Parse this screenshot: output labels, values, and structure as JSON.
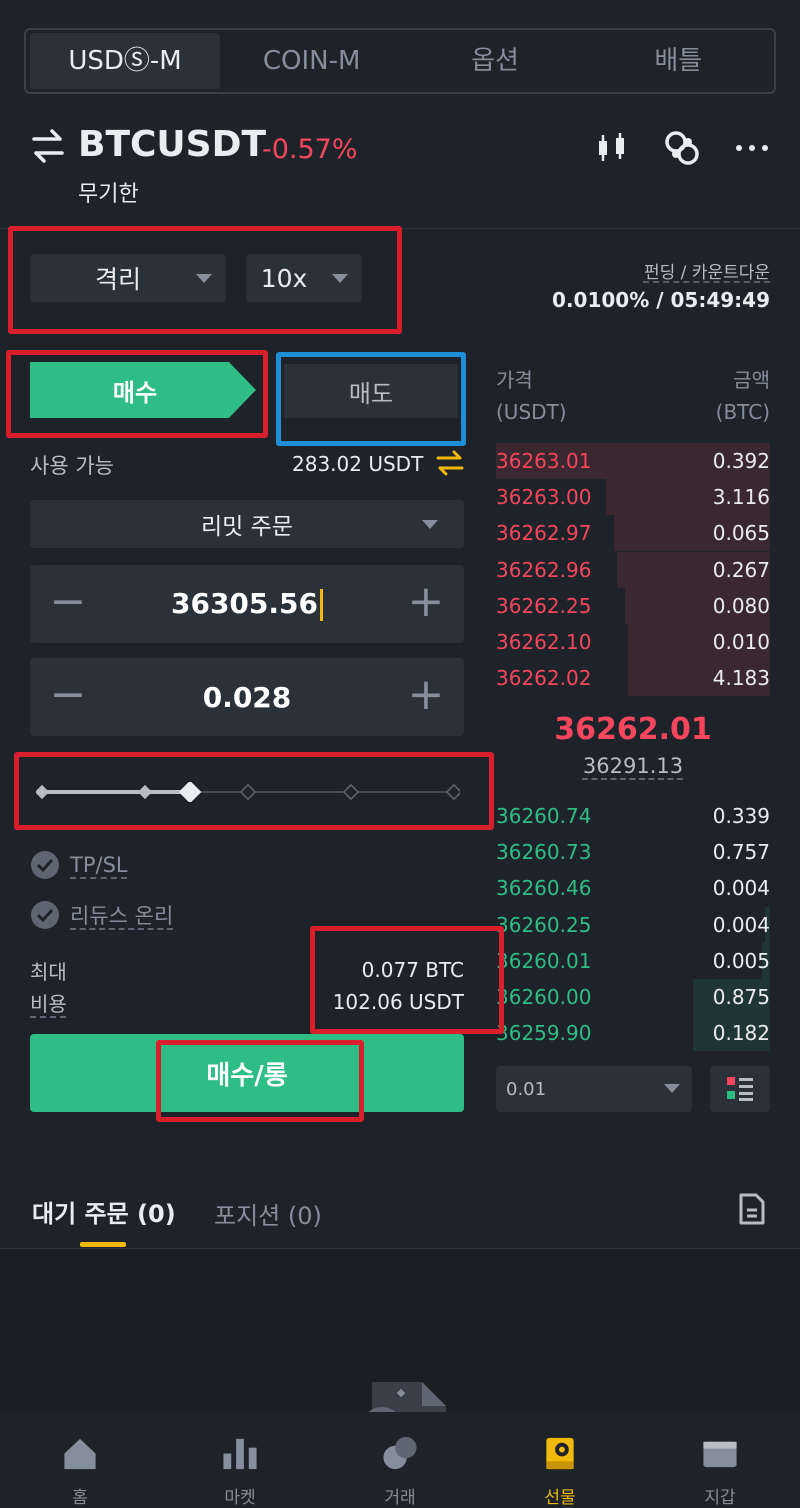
{
  "top_tabs": [
    "USDⓈ-M",
    "COIN-M",
    "옵션",
    "배틀"
  ],
  "header": {
    "symbol": "BTCUSDT",
    "change": "-0.57%",
    "contract_type": "무기한"
  },
  "margin": {
    "mode": "격리",
    "leverage": "10x"
  },
  "funding": {
    "label": "펀딩 / 카운트다운",
    "value": "0.0100% / 05:49:49"
  },
  "side_tabs": {
    "buy": "매수",
    "sell": "매도"
  },
  "available": {
    "label": "사용 가능",
    "value": "283.02 USDT"
  },
  "order_type": "리밋 주문",
  "price_input": {
    "value": "36305.56"
  },
  "amount_input": {
    "value": "0.028"
  },
  "leverage_slider": {
    "percent": 25
  },
  "options": {
    "tpsl": "TP/SL",
    "reduce_only": "리듀스 온리"
  },
  "summary": {
    "max_label": "최대",
    "cost_label": "비용",
    "max_value": "0.077 BTC",
    "cost_value": "102.06 USDT"
  },
  "submit_label": "매수/롱",
  "orderbook": {
    "price_header": "가격",
    "price_unit": "(USDT)",
    "amount_header": "금액",
    "amount_unit": "(BTC)",
    "asks": [
      {
        "price": "36263.01",
        "qty": "0.392",
        "depth": 1.0
      },
      {
        "price": "36263.00",
        "qty": "3.116",
        "depth": 0.6
      },
      {
        "price": "36262.97",
        "qty": "0.065",
        "depth": 0.57
      },
      {
        "price": "36262.96",
        "qty": "0.267",
        "depth": 0.56
      },
      {
        "price": "36262.25",
        "qty": "0.080",
        "depth": 0.53
      },
      {
        "price": "36262.10",
        "qty": "0.010",
        "depth": 0.52
      },
      {
        "price": "36262.02",
        "qty": "4.183",
        "depth": 0.52
      }
    ],
    "last_price": "36262.01",
    "mark_price": "36291.13",
    "bids": [
      {
        "price": "36260.74",
        "qty": "0.339",
        "depth": 0.0
      },
      {
        "price": "36260.73",
        "qty": "0.757",
        "depth": 0.0
      },
      {
        "price": "36260.46",
        "qty": "0.004",
        "depth": 0.0
      },
      {
        "price": "36260.25",
        "qty": "0.004",
        "depth": 0.02
      },
      {
        "price": "36260.01",
        "qty": "0.005",
        "depth": 0.03
      },
      {
        "price": "36260.00",
        "qty": "0.875",
        "depth": 0.28
      },
      {
        "price": "36259.90",
        "qty": "0.182",
        "depth": 0.28
      }
    ],
    "precision": "0.01"
  },
  "order_tabs": {
    "open_orders": "대기 주문 (0)",
    "positions": "포지션 (0)"
  },
  "bottom_nav": [
    "홈",
    "마켓",
    "거래",
    "선물",
    "지갑"
  ],
  "colors": {
    "buy": "#2ebd85",
    "sell": "#f6465d",
    "accent": "#f0b90b",
    "bg": "#1e2329"
  }
}
